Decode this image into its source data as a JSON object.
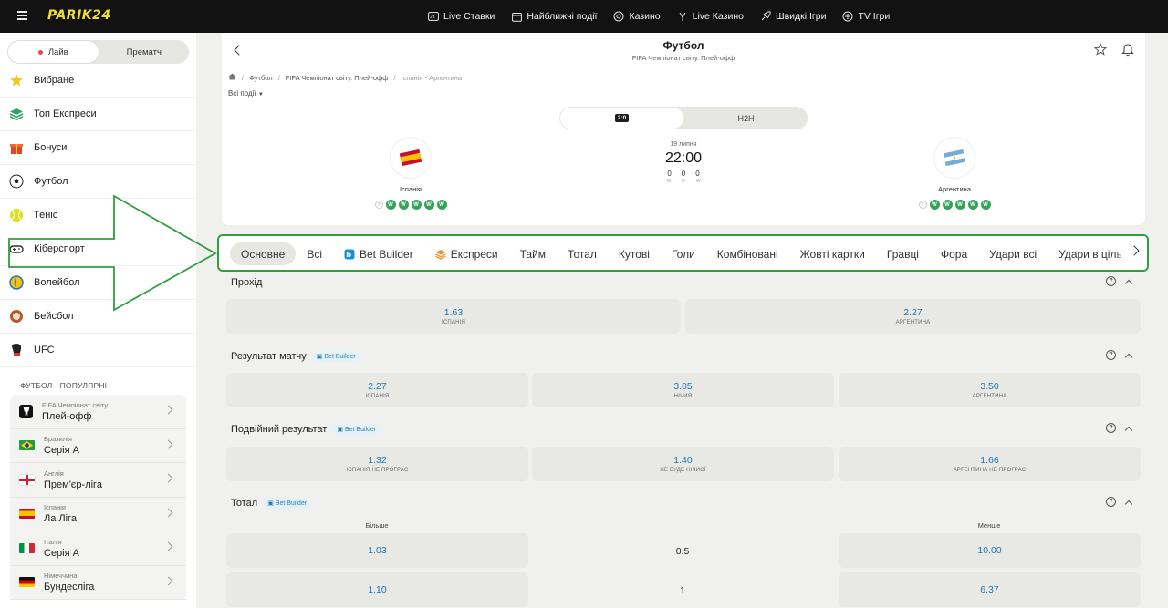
{
  "topbar": {
    "logo": "PARIK24",
    "nav": [
      {
        "label": "Live Ставки",
        "icon": "live-bets-icon"
      },
      {
        "label": "Найближчі події",
        "icon": "calendar-icon"
      },
      {
        "label": "Казино",
        "icon": "casino-chip-icon"
      },
      {
        "label": "Live Казино",
        "icon": "live-casino-icon"
      },
      {
        "label": "Швидкі Ігри",
        "icon": "rocket-icon"
      },
      {
        "label": "TV Ігри",
        "icon": "tv-games-icon"
      }
    ]
  },
  "sidebar": {
    "toggle": {
      "live": "Лайв",
      "prematch": "Прематч"
    },
    "items": [
      {
        "label": "Вибране",
        "icon": "star-icon"
      },
      {
        "label": "Топ Експреси",
        "icon": "layers-icon"
      },
      {
        "label": "Бонуси",
        "icon": "gift-icon"
      },
      {
        "label": "Футбол",
        "icon": "football-icon"
      },
      {
        "label": "Теніс",
        "icon": "tennis-ball-icon"
      },
      {
        "label": "Кіберспорт",
        "icon": "gamepad-icon"
      },
      {
        "label": "Волейбол",
        "icon": "volleyball-icon"
      },
      {
        "label": "Бейсбол",
        "icon": "baseball-icon"
      },
      {
        "label": "UFC",
        "icon": "boxing-glove-icon"
      }
    ],
    "popular_title": "ФУТБОЛ · ПОПУЛЯРНІ",
    "leagues": [
      {
        "country": "FIFA Чемпіонат світу",
        "name": "Плей-офф",
        "flag": "fifa"
      },
      {
        "country": "Бразилія",
        "name": "Серія А",
        "flag": "br"
      },
      {
        "country": "Англія",
        "name": "Прем'єр-ліга",
        "flag": "en"
      },
      {
        "country": "Іспанія",
        "name": "Ла Ліга",
        "flag": "es"
      },
      {
        "country": "Італія",
        "name": "Серія А",
        "flag": "it"
      },
      {
        "country": "Німеччина",
        "name": "Бундесліга",
        "flag": "de"
      }
    ]
  },
  "event": {
    "sport": "Футбол",
    "subtitle": "FIFA Чемпіонат світу. Плей-офф",
    "breadcrumb": [
      "Футбол",
      "FIFA Чемпіонат світу. Плей-офф",
      "Іспанія - Аргентина"
    ],
    "all_events": "Всі події",
    "score_tab": "2:0",
    "h2h_tab": "H2H",
    "date": "19 липня",
    "time": "22:00",
    "score": [
      "0",
      "0",
      "0"
    ],
    "score_labels": [
      "W",
      "D",
      "W"
    ],
    "home": {
      "name": "Іспанія",
      "form": [
        "?",
        "W",
        "W",
        "W",
        "W",
        "W"
      ]
    },
    "away": {
      "name": "Аргентина",
      "form": [
        "?",
        "W",
        "W",
        "W",
        "W",
        "W"
      ]
    }
  },
  "tabs": [
    {
      "label": "Основне",
      "active": true
    },
    {
      "label": "Всі"
    },
    {
      "label": "Bet Builder",
      "icon": "bet-builder-icon"
    },
    {
      "label": "Експреси",
      "icon": "layers-icon"
    },
    {
      "label": "Тайм"
    },
    {
      "label": "Тотал"
    },
    {
      "label": "Кутові"
    },
    {
      "label": "Голи"
    },
    {
      "label": "Комбіновані"
    },
    {
      "label": "Жовті картки"
    },
    {
      "label": "Гравці"
    },
    {
      "label": "Фора"
    },
    {
      "label": "Удари всі"
    },
    {
      "label": "Удари в ціль"
    }
  ],
  "bet_builder_chip": "Bet Builder",
  "markets": {
    "pass": {
      "title": "Прохід",
      "odds": [
        {
          "value": "1.63",
          "label": "ІСПАНІЯ"
        },
        {
          "value": "2.27",
          "label": "АРГЕНТИНА"
        }
      ]
    },
    "result": {
      "title": "Результат матчу",
      "odds": [
        {
          "value": "2.27",
          "label": "ІСПАНІЯ"
        },
        {
          "value": "3.05",
          "label": "НІЧИЯ"
        },
        {
          "value": "3.50",
          "label": "АРГЕНТИНА"
        }
      ]
    },
    "double": {
      "title": "Подвійний результат",
      "odds": [
        {
          "value": "1.32",
          "label": "ІСПАНІЯ НЕ ПРОГРАЄ"
        },
        {
          "value": "1.40",
          "label": "НЕ БУДЕ НІЧИЄЇ"
        },
        {
          "value": "1.66",
          "label": "АРГЕНТИНА НЕ ПРОГРАЄ"
        }
      ]
    },
    "total": {
      "title": "Тотал",
      "over_label": "Більше",
      "under_label": "Менше",
      "rows": [
        {
          "over": "1.03",
          "line": "0.5",
          "under": "10.00"
        },
        {
          "over": "1.10",
          "line": "1",
          "under": "6.37"
        }
      ]
    }
  },
  "colors": {
    "accent_yellow": "#f2dd2f",
    "odd_blue": "#1778b8",
    "highlight_green": "#2e9e3e",
    "form_green": "#33a35a"
  }
}
